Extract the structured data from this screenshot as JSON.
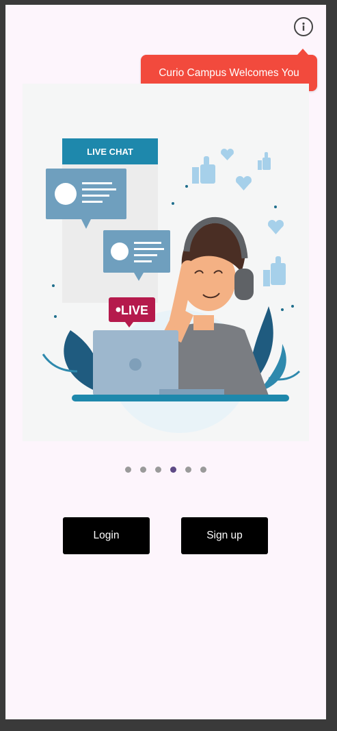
{
  "tooltip": {
    "text": "Curio Campus Welcomes You"
  },
  "illustration": {
    "chat_banner": "LIVE CHAT",
    "live_badge": "LIVE"
  },
  "carousel": {
    "count": 6,
    "active_index": 3
  },
  "actions": {
    "login_label": "Login",
    "signup_label": "Sign up"
  },
  "colors": {
    "tooltip_bg": "#f24a3d",
    "button_bg": "#000000",
    "active_dot": "#5e4a86",
    "screen_bg": "#fdf5fc"
  },
  "icons": {
    "info": "info-circle-icon"
  }
}
